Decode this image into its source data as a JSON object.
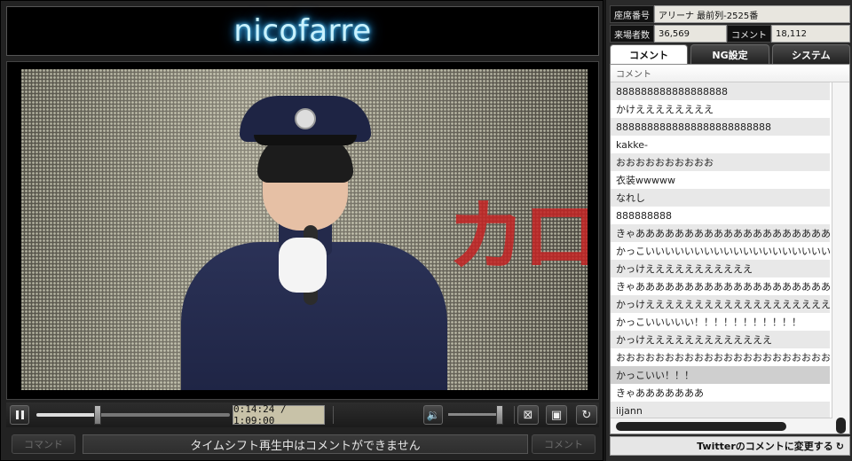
{
  "logo": {
    "text": "nicofarre"
  },
  "player": {
    "time_display": "0:14:24 / 1:09:00",
    "seek_fraction": 0.33,
    "volume_fraction": 0.95,
    "video_sign_text": "カロ"
  },
  "command_bar": {
    "command_label": "コマンド",
    "input_placeholder": "タイムシフト再生中はコメントができません",
    "comment_label": "コメント"
  },
  "info": {
    "seat_label": "座席番号",
    "seat_value": "アリーナ 最前列-2525番",
    "visitors_label": "来場者数",
    "visitors_value": "36,569",
    "comments_label": "コメント",
    "comments_value": "18,112"
  },
  "tabs": [
    {
      "label": "コメント",
      "active": true
    },
    {
      "label": "NG設定",
      "active": false
    },
    {
      "label": "システム",
      "active": false
    }
  ],
  "comment_list": {
    "header": "コメント",
    "rows": [
      "888888888888888888",
      "かけええええええええ",
      "8888888888888888888888888",
      "kakke-",
      "おおおおおおおおおお",
      "衣装wwwww",
      "なれし",
      "888888888",
      "きゃあああああああああああああああああああああ",
      "かっこいいいいいいいいいいいいいいいいいいいいいいい",
      "かっけえええええええええええ",
      "きゃあああああああああああああああああああああ",
      "かっけええええええええええええええええええええええ",
      "かっこいいいいい！！！！！！！！！！！",
      "かっけえええええええええええええ",
      "おおおおおおおおおおおおおおおおおおおおおおおおおおお",
      "かっこいい！！！",
      "きゃあああああああ",
      "iijann"
    ],
    "selected_index": 16
  },
  "twitter_button": {
    "label": "Twitterのコメントに変更する"
  },
  "colors": {
    "logo_glow": "#2aa8ff",
    "selected_row": "#cfcfcf",
    "time_box": "#c8c2a8"
  },
  "icons": {
    "pause": "pause-icon",
    "volume": "speaker-icon",
    "comment_toggle": "comment-hide-icon",
    "screen": "screen-icon",
    "reload": "reload-icon",
    "twitter_refresh": "refresh-icon"
  }
}
